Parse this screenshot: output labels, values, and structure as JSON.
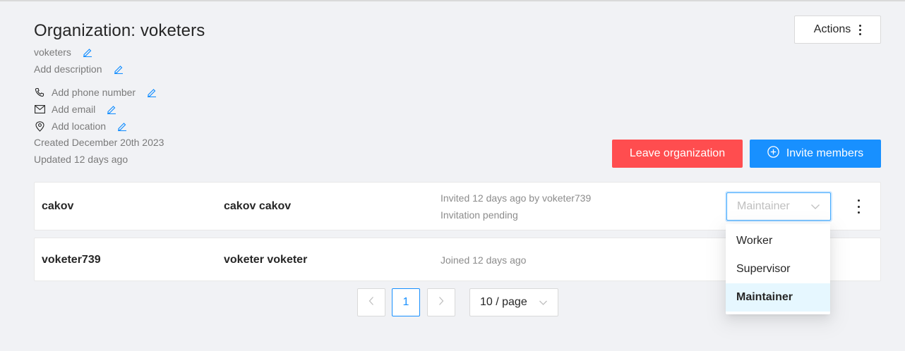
{
  "org": {
    "title": "Organization: voketers",
    "slug": "voketers",
    "description_placeholder": "Add description",
    "phone_placeholder": "Add phone number",
    "email_placeholder": "Add email",
    "location_placeholder": "Add location",
    "created": "Created December 20th 2023",
    "updated": "Updated 12 days ago"
  },
  "toolbar": {
    "actions_label": "Actions",
    "leave_label": "Leave organization",
    "invite_label": "Invite members"
  },
  "members": [
    {
      "username": "cakov",
      "full_name": "cakov cakov",
      "status_line1": "Invited 12 days ago by voketer739",
      "status_line2": "Invitation pending",
      "role_placeholder": "Maintainer"
    },
    {
      "username": "voketer739",
      "full_name": "voketer voketer",
      "status_line1": "Joined 12 days ago"
    }
  ],
  "role_dropdown": {
    "options": [
      "Worker",
      "Supervisor",
      "Maintainer"
    ],
    "selected": "Maintainer"
  },
  "pagination": {
    "prev": "<",
    "current_page": "1",
    "next": ">",
    "page_size": "10 / page"
  },
  "colors": {
    "primary": "#1890ff",
    "danger": "#ff4d4f",
    "link_edit": "#1890ff",
    "background": "#f1f2f5"
  },
  "icons": [
    "edit-icon",
    "phone-icon",
    "mail-icon",
    "location-icon",
    "more-vertical-icon",
    "plus-circle-icon",
    "chevron-down-icon",
    "chevron-left-icon",
    "chevron-right-icon"
  ]
}
